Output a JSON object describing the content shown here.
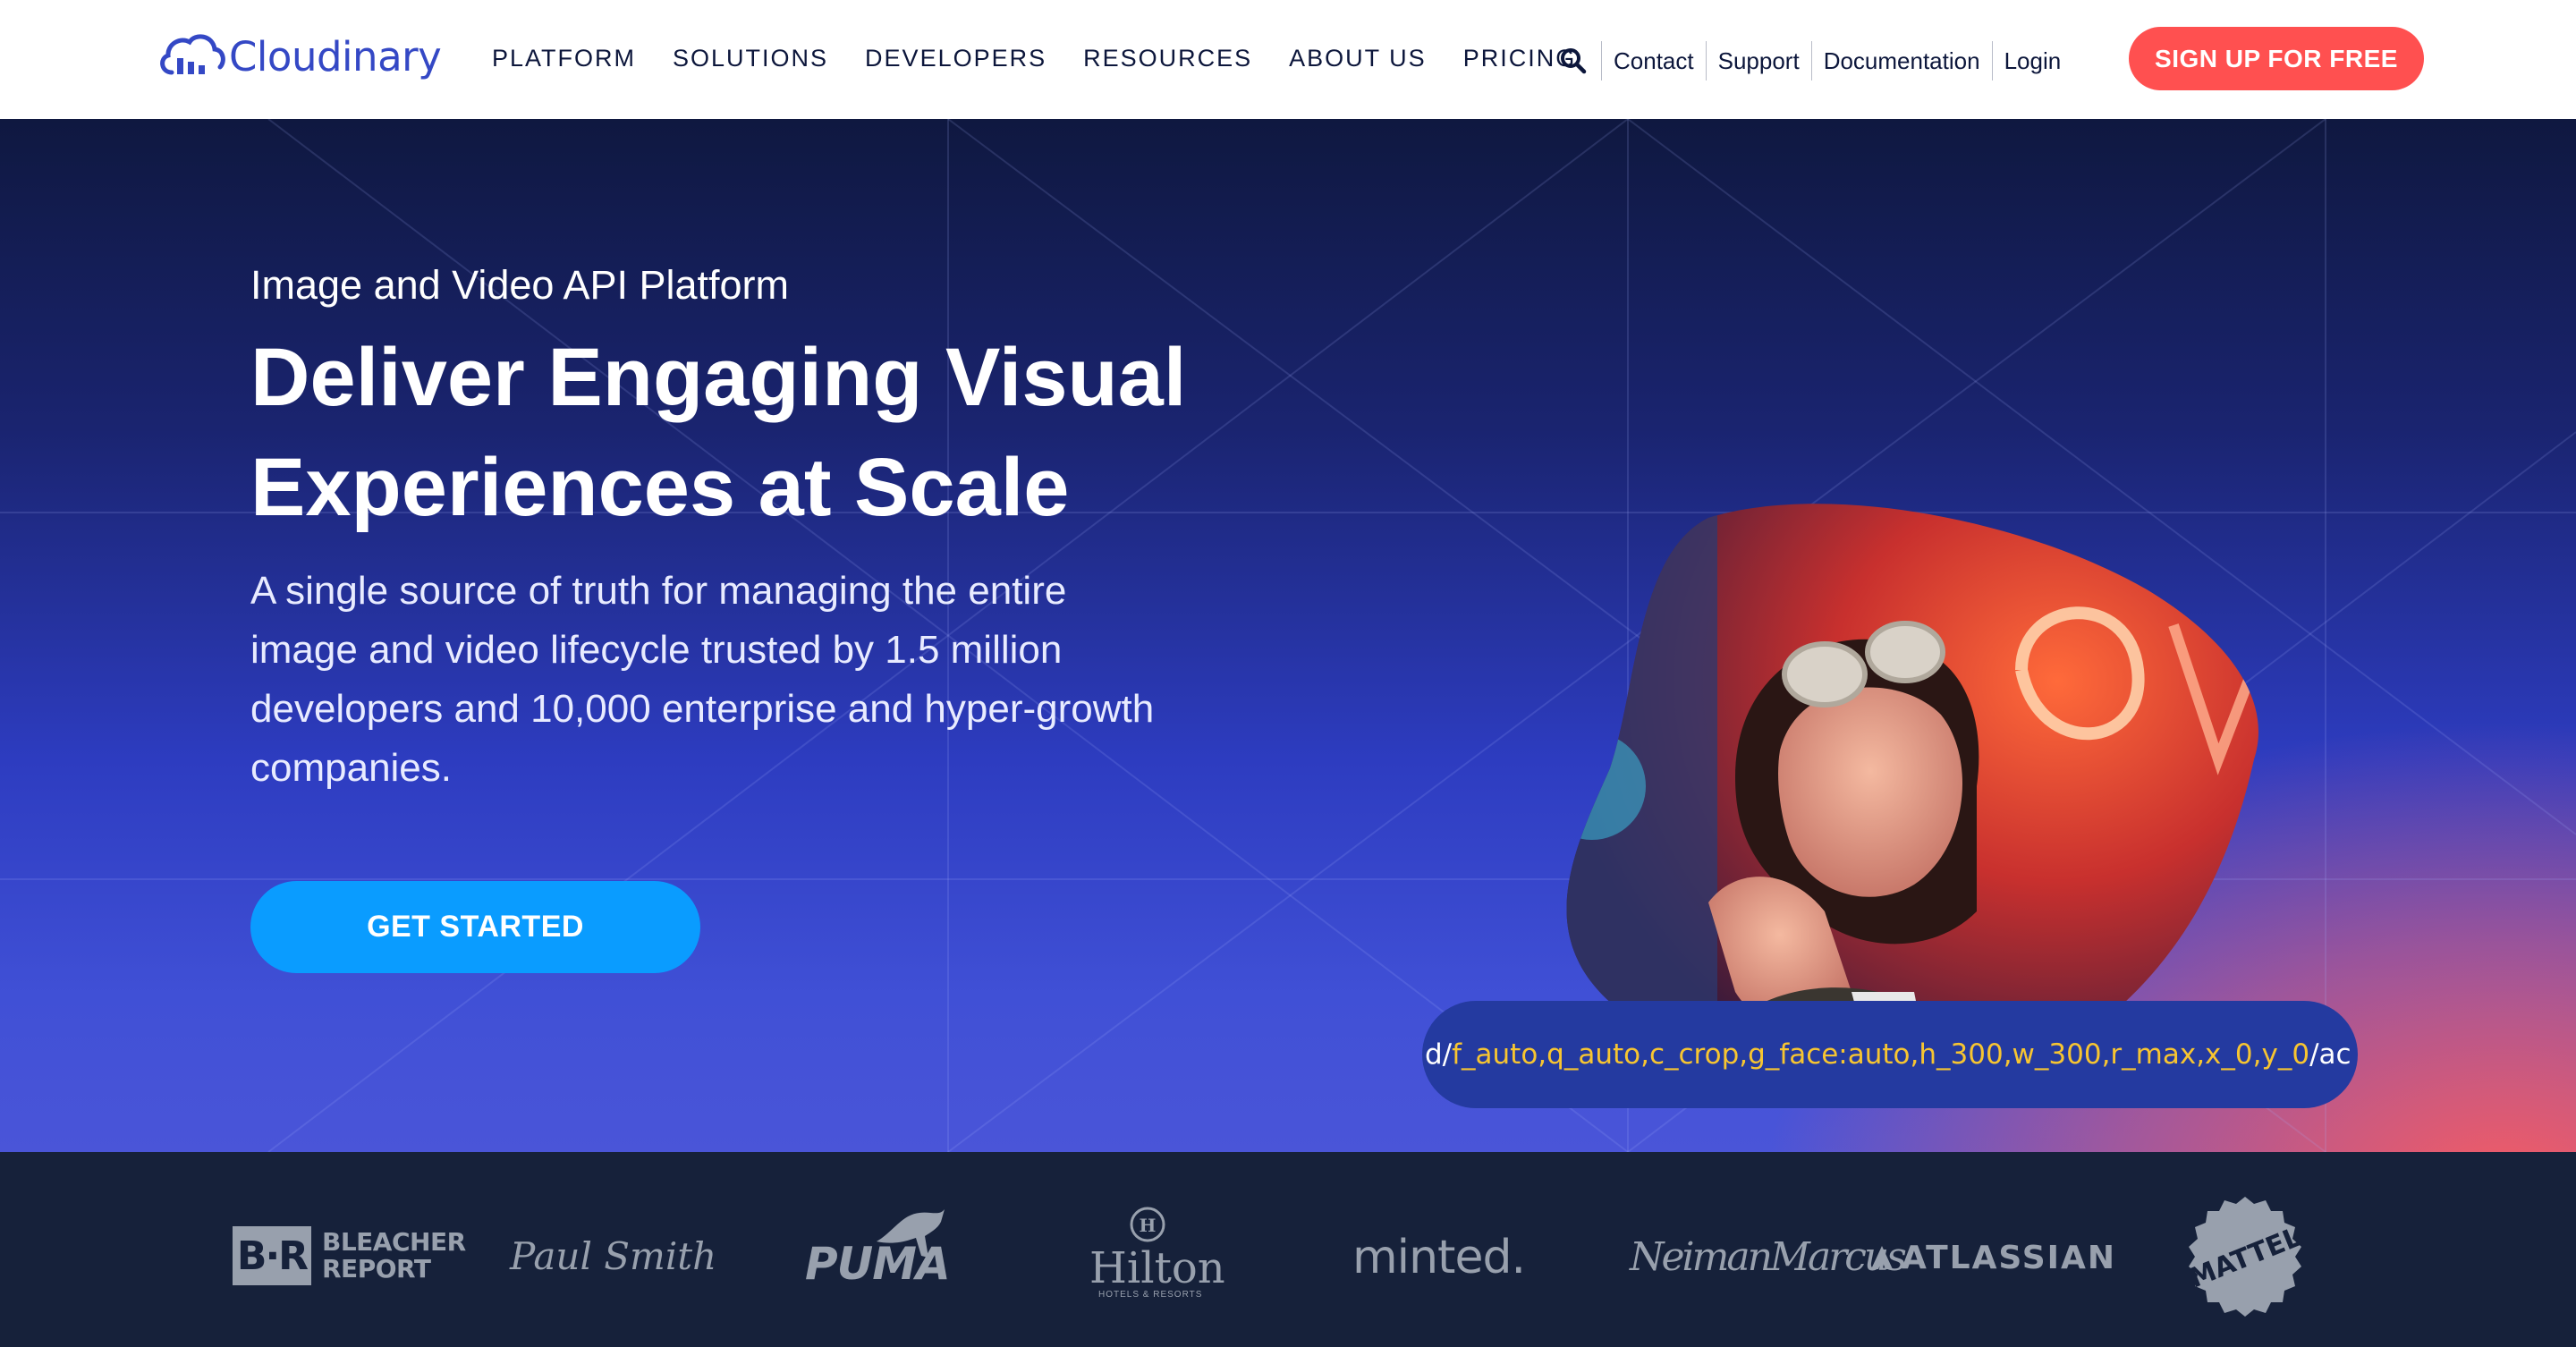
{
  "nav": {
    "logo_text": "Cloudinary",
    "menu": [
      "PLATFORM",
      "SOLUTIONS",
      "DEVELOPERS",
      "RESOURCES",
      "ABOUT US",
      "PRICING"
    ],
    "utility_links": [
      "Contact",
      "Support",
      "Documentation",
      "Login"
    ],
    "signup_label": "SIGN UP FOR FREE"
  },
  "hero": {
    "eyebrow": "Image and Video API Platform",
    "headline": "Deliver Engaging Visual Experiences at Scale",
    "lead": "A single source of truth for managing the entire image and video lifecycle trusted by 1.5 million developers and 10,000 enterprise and hyper-growth companies.",
    "cta_label": "GET STARTED",
    "url_prefix": "d/",
    "url_params": "f_auto,q_auto,c_crop,g_face:auto,h_300,w_300,r_max,x_0,y_0",
    "url_suffix": "/ac"
  },
  "customers": {
    "bleacher_mark": "B·R",
    "bleacher_text_1": "BLEACHER",
    "bleacher_text_2": "REPORT",
    "paul_smith": "Paul Smith",
    "puma": "PUMA",
    "hilton": "Hilton",
    "hilton_sub": "HOTELS & RESORTS",
    "minted": "minted.",
    "neiman_marcus": "NeimanMarcus",
    "atlassian": "ATLASSIAN",
    "mattel": "MATTEL"
  },
  "colors": {
    "brand": "#3448c5",
    "signup": "#ff5050",
    "cta": "#0a9cff",
    "url_highlight": "#f7c531",
    "logo_strip": "#16213a"
  }
}
